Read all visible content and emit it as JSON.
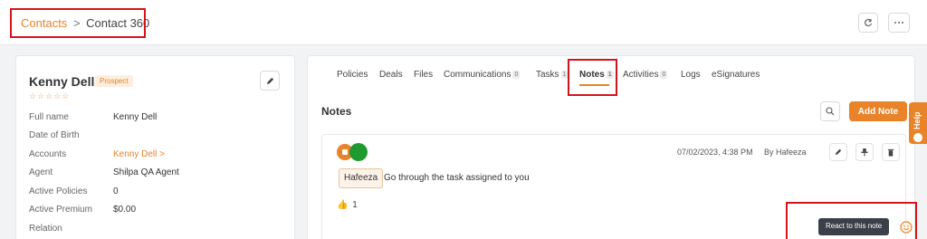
{
  "breadcrumb": {
    "parent": "Contacts",
    "separator": ">",
    "current": "Contact 360"
  },
  "contact": {
    "name": "Kenny Dell",
    "status": "Prospect",
    "rating": "☆☆☆☆☆",
    "fields": [
      {
        "label": "Full name",
        "value": "Kenny Dell"
      },
      {
        "label": "Date of Birth",
        "value": ""
      },
      {
        "label": "Accounts",
        "value": "Kenny Dell >"
      },
      {
        "label": "Agent",
        "value": "Shilpa QA Agent"
      },
      {
        "label": "Active Policies",
        "value": "0"
      },
      {
        "label": "Active Premium",
        "value": "$0.00"
      },
      {
        "label": "Relation",
        "value": ""
      }
    ]
  },
  "tabs": [
    {
      "label": "Policies",
      "count": ""
    },
    {
      "label": "Deals",
      "count": ""
    },
    {
      "label": "Files",
      "count": ""
    },
    {
      "label": "Communications",
      "count": "0"
    },
    {
      "label": "Tasks",
      "count": "1"
    },
    {
      "label": "Notes",
      "count": "1"
    },
    {
      "label": "Activities",
      "count": "0"
    },
    {
      "label": "Logs",
      "count": ""
    },
    {
      "label": "eSignatures",
      "count": ""
    }
  ],
  "active_tab": "Notes",
  "notes_section": {
    "title": "Notes",
    "add_button": "Add Note"
  },
  "note": {
    "datetime": "07/02/2023, 4:38 PM",
    "author": "By Hafeeza",
    "mention": "Hafeeza",
    "text": "Go through the task assigned to you",
    "reaction_emoji": "👍",
    "reaction_count": "1",
    "tooltip": "React to this note"
  },
  "help": {
    "label": "Help"
  },
  "colors": {
    "accent": "#e8832a",
    "highlight": "#d4141c",
    "avatar_green": "#1e9a2f"
  }
}
